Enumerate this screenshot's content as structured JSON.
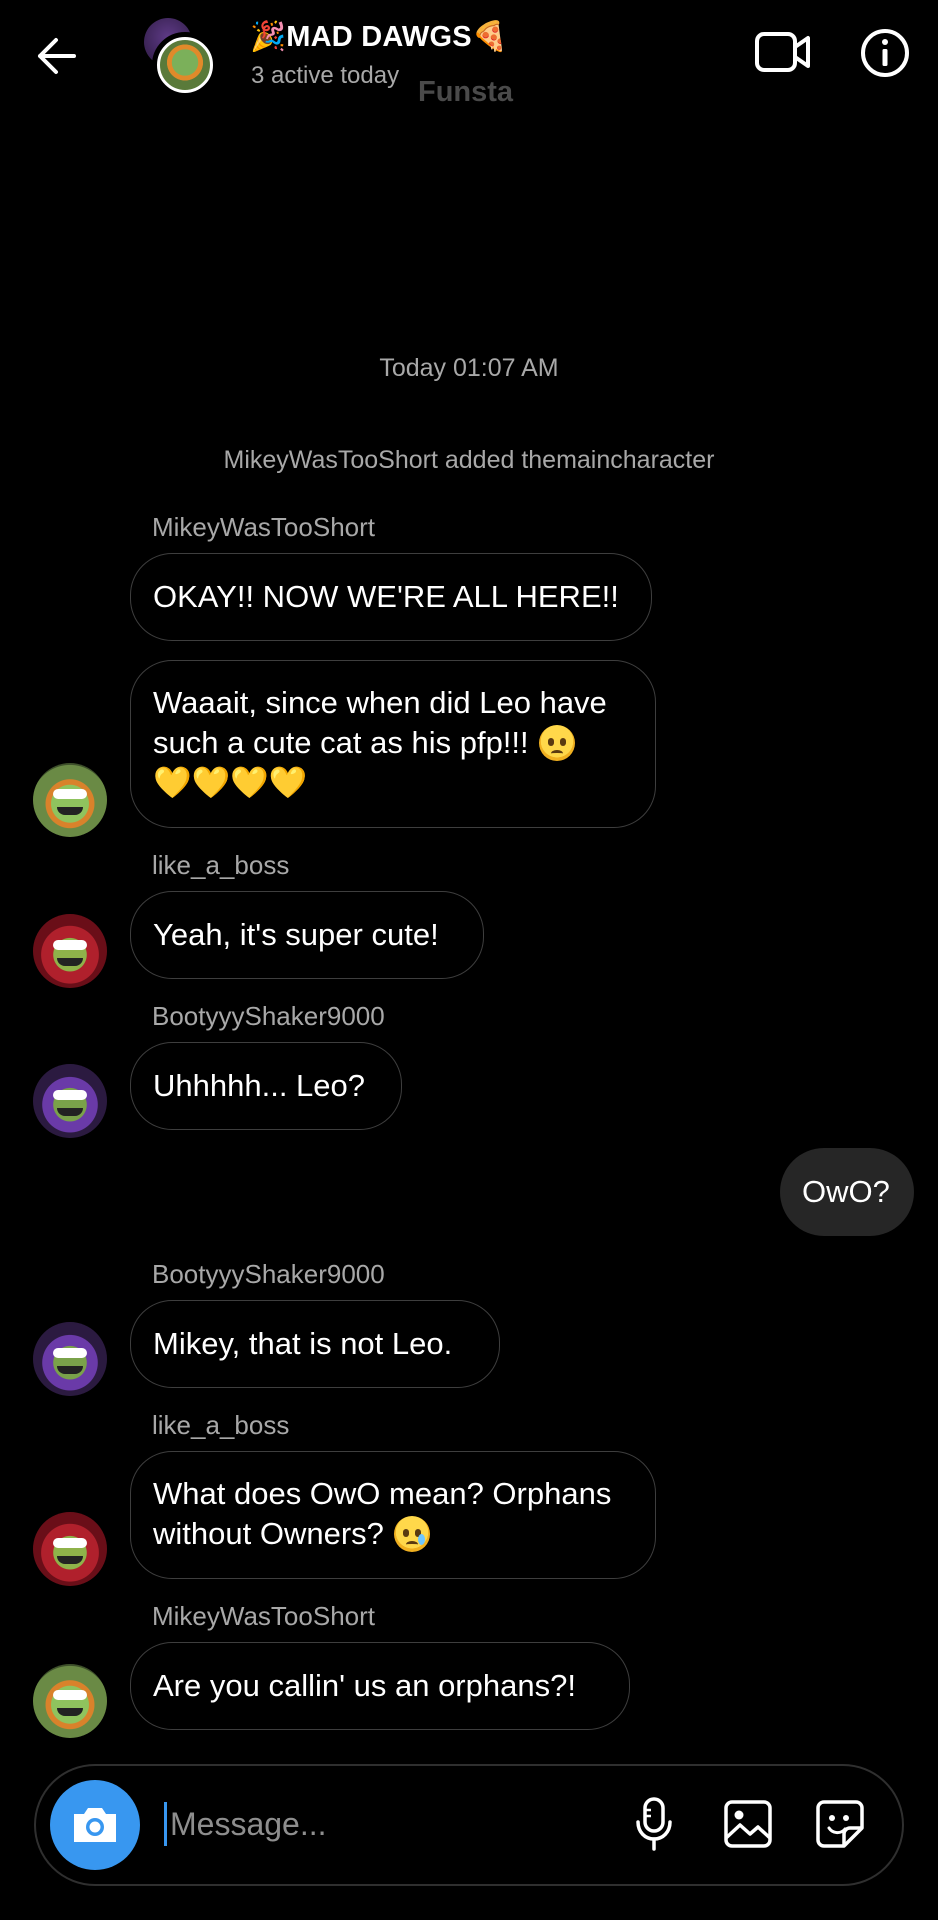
{
  "header": {
    "title": "🎉MAD DAWGS🍕",
    "status": "3 active today",
    "account_label": "Funsta",
    "icons": [
      "arrow-left-icon",
      "video-camera-icon",
      "info-icon"
    ]
  },
  "thread": {
    "timestamp": "Today 01:07 AM",
    "system_message": "MikeyWasTooShort added themaincharacter",
    "messages": [
      {
        "sender": "MikeyWasTooShort",
        "text": "OKAY!! NOW WE'RE ALL HERE!!"
      },
      {
        "text_line1": "Waaait, since when did Leo have",
        "text_line2": "such a cute cat as his pfp!!!",
        "emoji": "pleading-face",
        "hearts": "💛💛💛💛"
      },
      {
        "sender": "like_a_boss",
        "text": "Yeah, it's super cute!"
      },
      {
        "sender": "BootyyyShaker9000",
        "text": "Uhhhhh... Leo?"
      },
      {
        "outgoing": true,
        "text": "OwO?"
      },
      {
        "sender": "BootyyyShaker9000",
        "text": "Mikey, that is not Leo."
      },
      {
        "sender": "like_a_boss",
        "text_line1": "What does OwO mean? Orphans",
        "text_line2": "without Owners?",
        "emoji": "sad-tear-face"
      },
      {
        "sender": "MikeyWasTooShort",
        "text": "Are you callin' us an orphans?!"
      }
    ]
  },
  "composer": {
    "placeholder": "Message...",
    "accent_color": "#3897f0",
    "icons": [
      "camera-icon",
      "microphone-icon",
      "gallery-icon",
      "sticker-icon"
    ]
  }
}
